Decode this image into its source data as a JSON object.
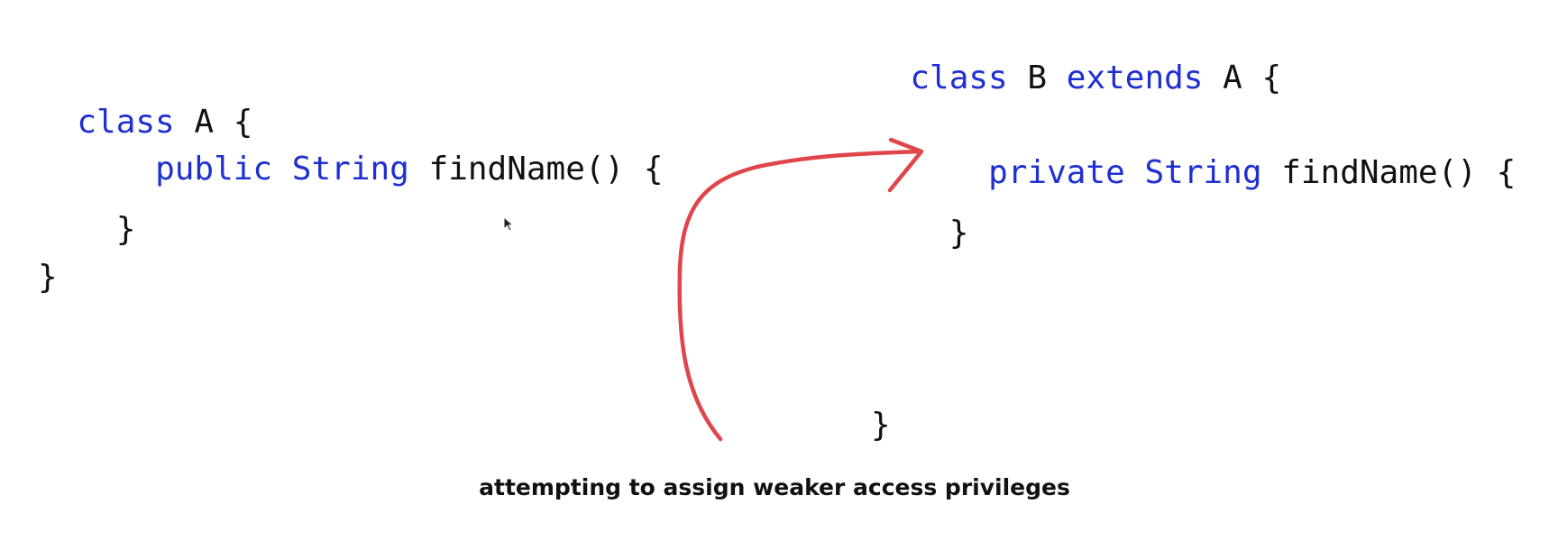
{
  "class_a": {
    "line1": {
      "kw": "class",
      "rest": " A {"
    },
    "line2": {
      "indent": "    ",
      "kw1": "public",
      "kw2": "String",
      "rest": " findName() {"
    },
    "line3": "    }",
    "line4": "}"
  },
  "class_b": {
    "line1": {
      "kw1": "class",
      "mid": " B ",
      "kw2": "extends",
      "rest": " A {"
    },
    "line2": {
      "indent": "    ",
      "kw1": "private",
      "kw2": "String",
      "rest": " findName() {"
    },
    "line3": "    }",
    "line4": "}"
  },
  "caption": "attempting to assign weaker access privileges",
  "colors": {
    "keyword": "#1f2fd0",
    "text": "#111111",
    "arrow": "#e0454c"
  },
  "icons": {
    "pointer": "mouse-pointer-icon",
    "arrow": "curved-arrow-icon"
  }
}
